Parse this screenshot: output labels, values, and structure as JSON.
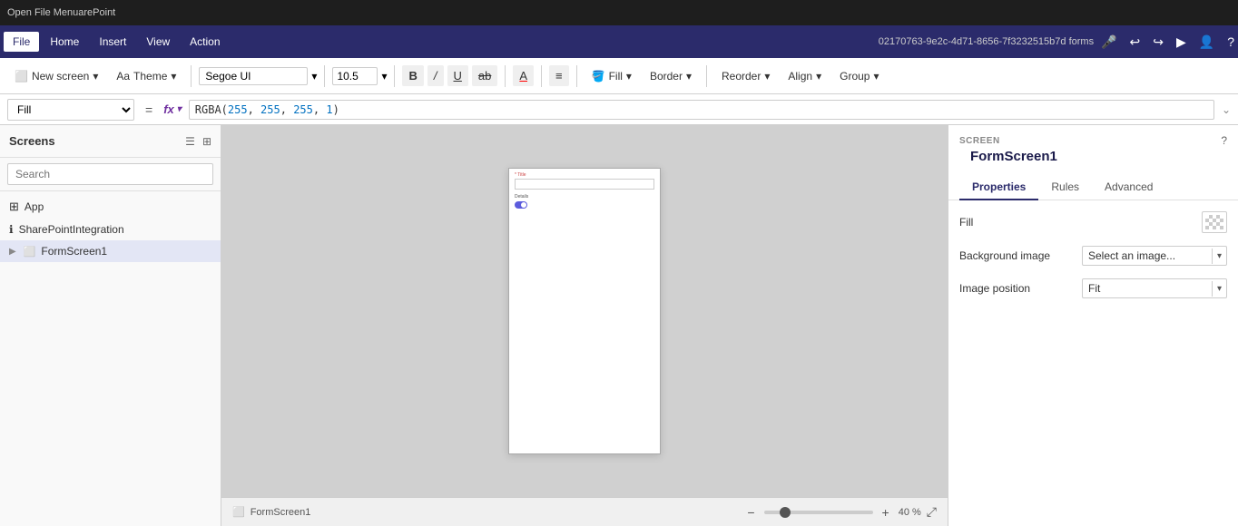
{
  "topbar": {
    "text": "Open File Menu",
    "sharepoint": "arePoint"
  },
  "menubar": {
    "items": [
      "File",
      "Home",
      "Insert",
      "View",
      "Action"
    ],
    "active": "Home",
    "file_label": "File",
    "doc_id": "02170763-9e2c-4d71-8656-7f3232515b7d forms"
  },
  "toolbar": {
    "new_screen": "New screen",
    "theme": "Theme",
    "font_name": "Segoe UI",
    "font_size": "10.5",
    "bold": "B",
    "italic": "I",
    "underline": "U",
    "strikethrough": "ab",
    "font_color": "A",
    "align": "≡",
    "fill": "Fill",
    "border": "Border",
    "reorder": "Reorder",
    "align_label": "Align",
    "group": "Group"
  },
  "formula_bar": {
    "property": "Fill",
    "eq": "=",
    "fx": "fx",
    "formula": "RGBA(255, 255, 255, 1)",
    "rgba_prefix": "RGBA(",
    "rgba_nums": "255, 255, 255, 1",
    "rgba_suffix": ")"
  },
  "screens_panel": {
    "title": "Screens",
    "search_placeholder": "Search",
    "items": [
      {
        "id": "app",
        "label": "App",
        "icon": "grid",
        "indent": 0
      },
      {
        "id": "sharepointintegration",
        "label": "SharePointIntegration",
        "icon": "circle-info",
        "indent": 0
      },
      {
        "id": "formscreen1",
        "label": "FormScreen1",
        "icon": "rectangle",
        "indent": 1
      }
    ]
  },
  "canvas": {
    "frame_title_label": "* Title",
    "frame_details_label": "Details",
    "bottom_screen": "FormScreen1",
    "zoom_minus": "−",
    "zoom_plus": "+",
    "zoom_value": "40 %",
    "zoom_level": 40
  },
  "right_panel": {
    "section_label": "SCREEN",
    "screen_name": "FormScreen1",
    "tabs": [
      "Properties",
      "Rules",
      "Advanced"
    ],
    "active_tab": "Properties",
    "fill_label": "Fill",
    "bg_image_label": "Background image",
    "bg_image_value": "Select an image...",
    "img_position_label": "Image position",
    "img_position_value": "Fit"
  }
}
